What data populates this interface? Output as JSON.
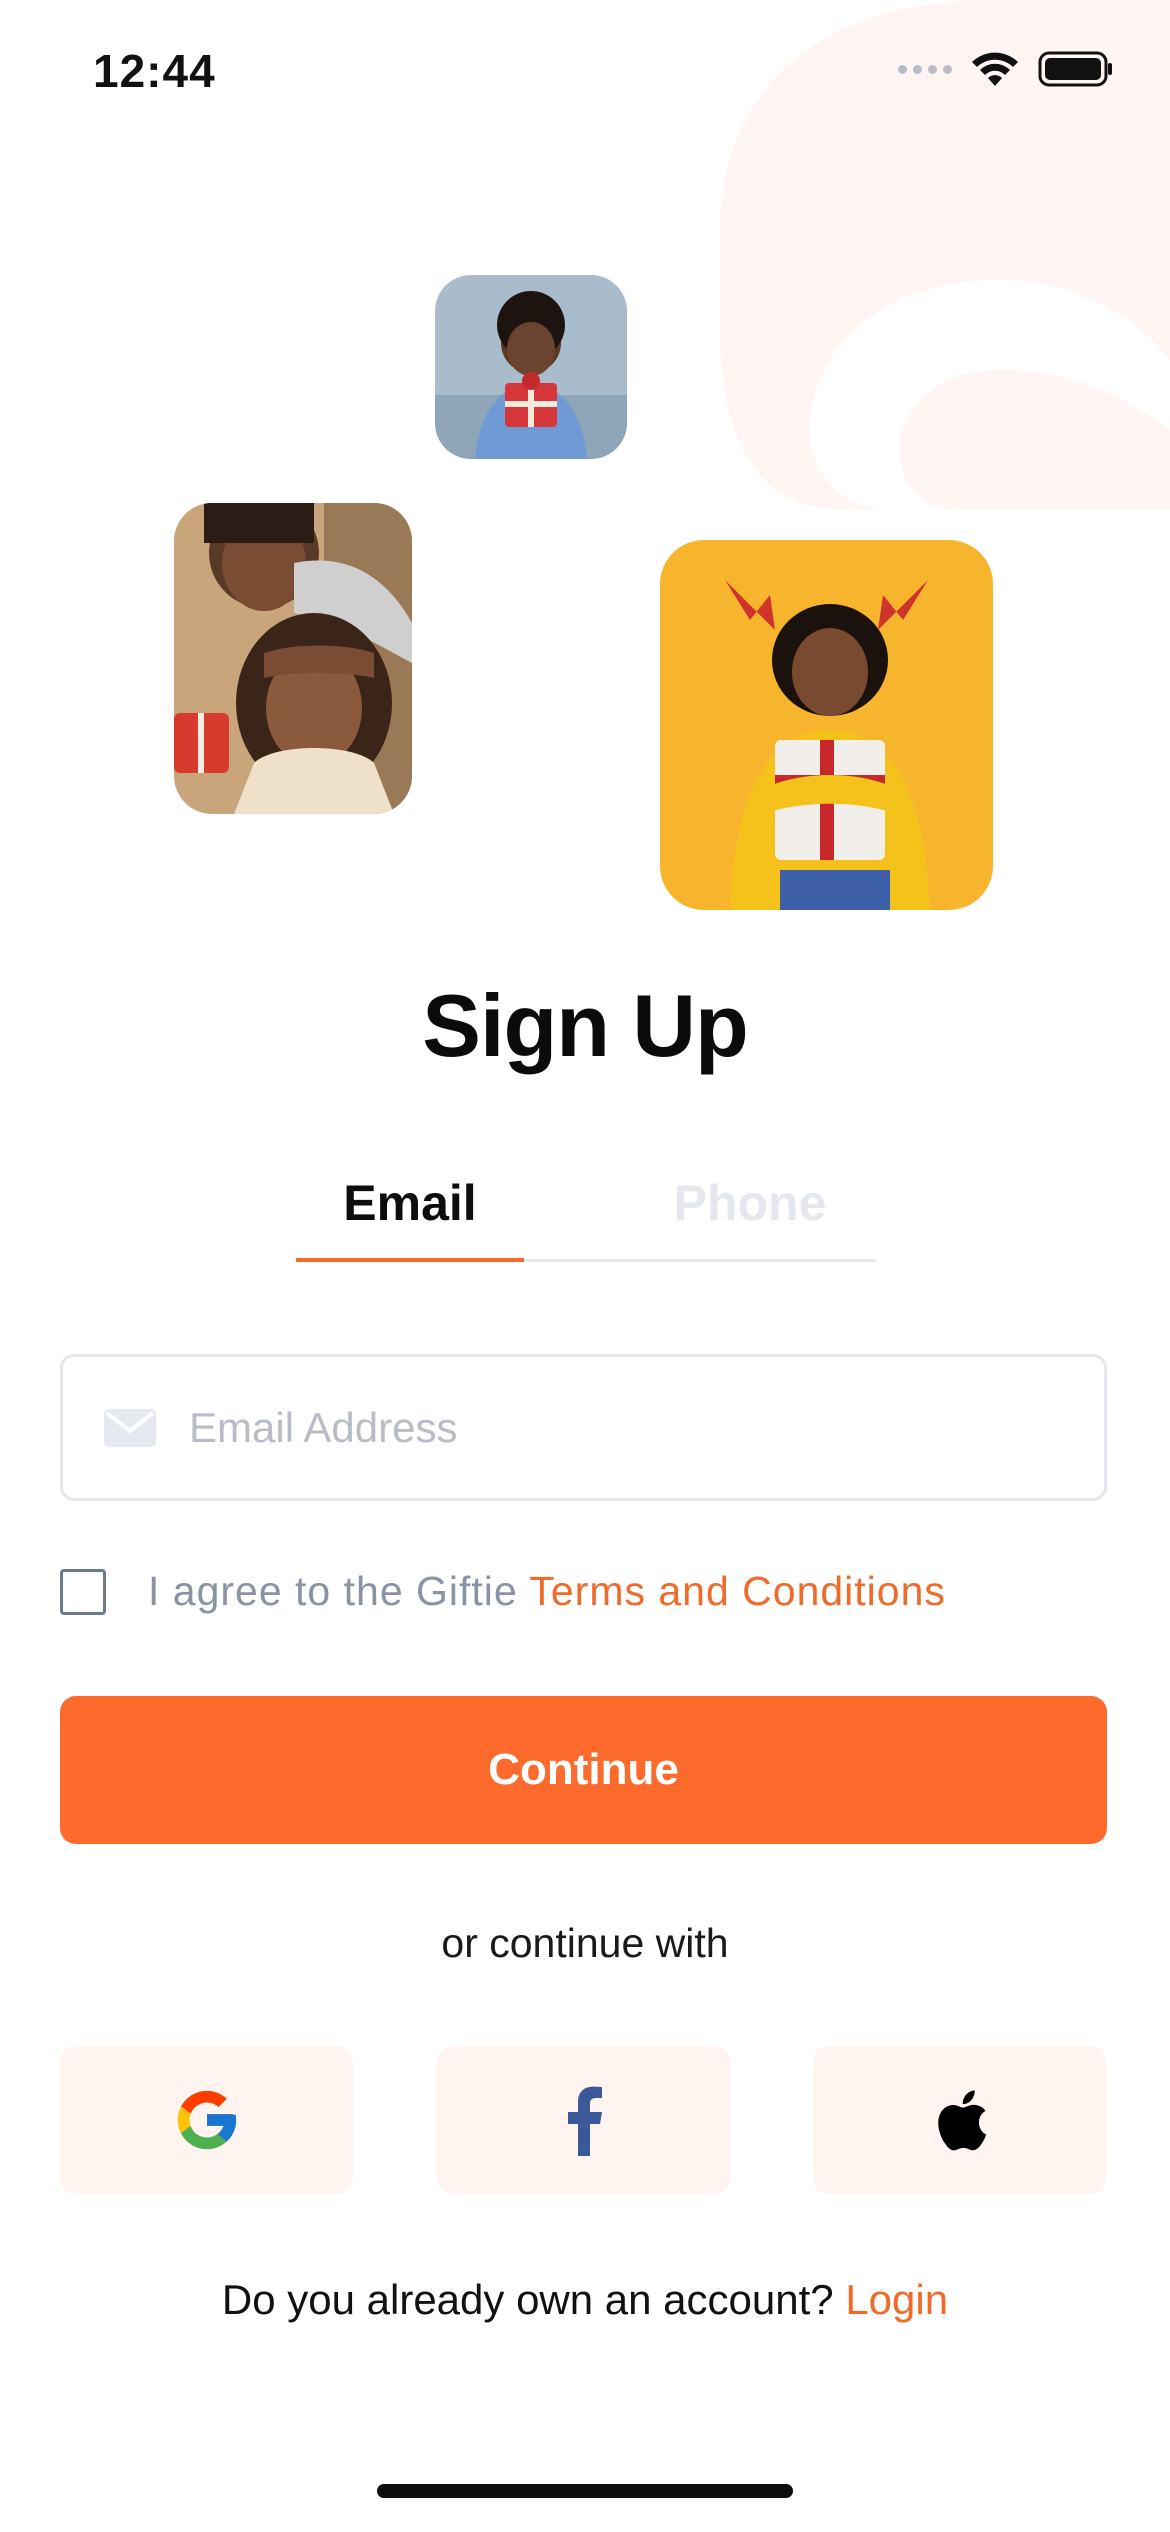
{
  "status_bar": {
    "time": "12:44"
  },
  "title": "Sign Up",
  "tabs": [
    {
      "label": "Email",
      "active": true
    },
    {
      "label": "Phone",
      "active": false
    }
  ],
  "email_field": {
    "placeholder": "Email Address",
    "value": "",
    "icon": "mail-icon"
  },
  "terms": {
    "checked": false,
    "prefix": "I agree to the Giftie ",
    "link_label": "Terms and Conditions"
  },
  "continue_label": "Continue",
  "or_text": "or continue with",
  "social": [
    {
      "name": "google",
      "icon": "google-icon"
    },
    {
      "name": "facebook",
      "icon": "facebook-icon"
    },
    {
      "name": "apple",
      "icon": "apple-icon"
    }
  ],
  "login": {
    "prompt": "Do you already own an account? ",
    "link_label": "Login"
  },
  "colors": {
    "accent": "#fd6b2c",
    "link": "#f06a2a",
    "social_bg": "#fff4f0",
    "muted_text": "#8a93a4",
    "border": "#e4e7ee"
  }
}
